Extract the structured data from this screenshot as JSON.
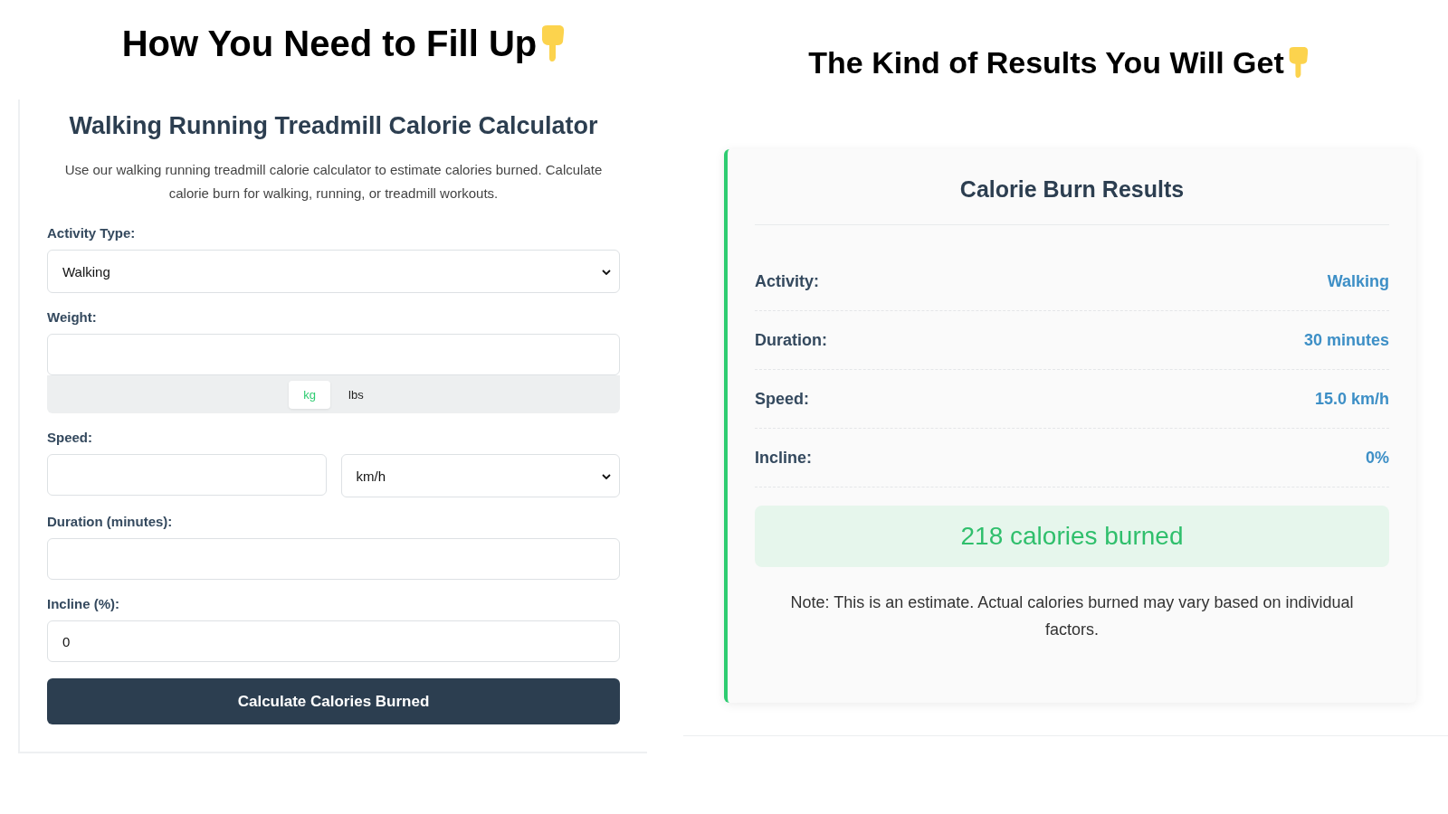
{
  "left_heading": {
    "text": "How You Need to Fill Up"
  },
  "calculator": {
    "title": "Walking Running Treadmill Calorie Calculator",
    "description": "Use our walking running treadmill calorie calculator to estimate calories burned. Calculate calorie burn for walking, running, or treadmill workouts.",
    "fields": [
      {
        "kind": "select",
        "label": "Activity Type:",
        "value": "Walking"
      },
      {
        "kind": "text",
        "label": "Weight:",
        "units": [
          {
            "label": "kg",
            "selected": true
          },
          {
            "label": "lbs",
            "selected": false
          }
        ]
      },
      {
        "kind": "text-select",
        "label": "Speed:",
        "select_value": "km/h"
      },
      {
        "kind": "text",
        "label": "Duration (minutes):"
      },
      {
        "kind": "text",
        "label": "Incline (%):",
        "value": "0"
      }
    ],
    "button": "Calculate Calories Burned"
  },
  "right_heading": {
    "text": "The Kind of Results You Will Get"
  },
  "results": {
    "title": "Calorie Burn Results",
    "rows": [
      {
        "label": "Activity:",
        "value": "Walking"
      },
      {
        "label": "Duration:",
        "value": "30 minutes"
      },
      {
        "label": "Speed:",
        "value": "15.0 km/h"
      },
      {
        "label": "Incline:",
        "value": "0%"
      }
    ],
    "total": "218 calories burned",
    "note": "Note: This is an estimate. Actual calories burned may vary based on individual factors."
  }
}
